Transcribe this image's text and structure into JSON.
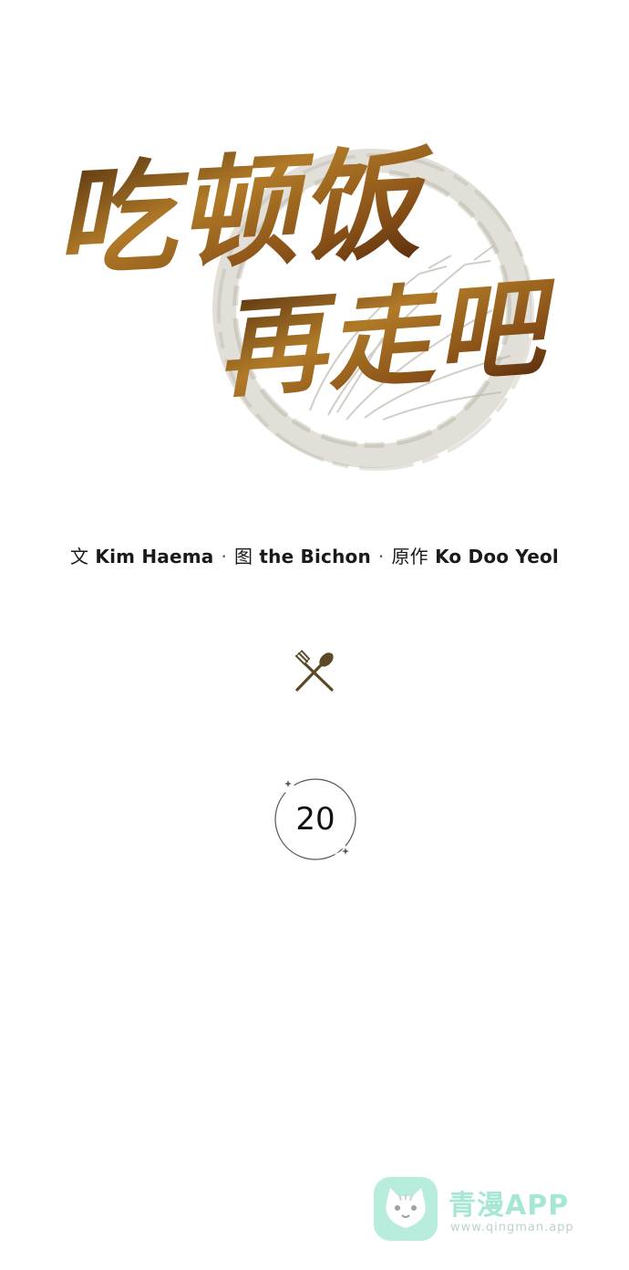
{
  "title": {
    "line1": "吃顿饭",
    "line2": "再走吧"
  },
  "credits": {
    "writer_role": "文",
    "writer": "Kim Haema",
    "artist_role": "图",
    "artist": "the Bichon",
    "original_role": "原作",
    "original": "Ko Doo Yeol",
    "separator": "·"
  },
  "episode": {
    "number": "20"
  },
  "watermark": {
    "name": "青漫APP",
    "url": "www.qingman.app"
  },
  "icons": {
    "divider": "fork-spoon-crossed-icon",
    "watermark": "cat-face-icon"
  },
  "colors": {
    "title_gold": "#a8721f",
    "title_dark": "#5c3210",
    "ink_circle": "#b8b4a6",
    "utensil": "#5a4a26",
    "watermark": "#5fd2b5"
  }
}
